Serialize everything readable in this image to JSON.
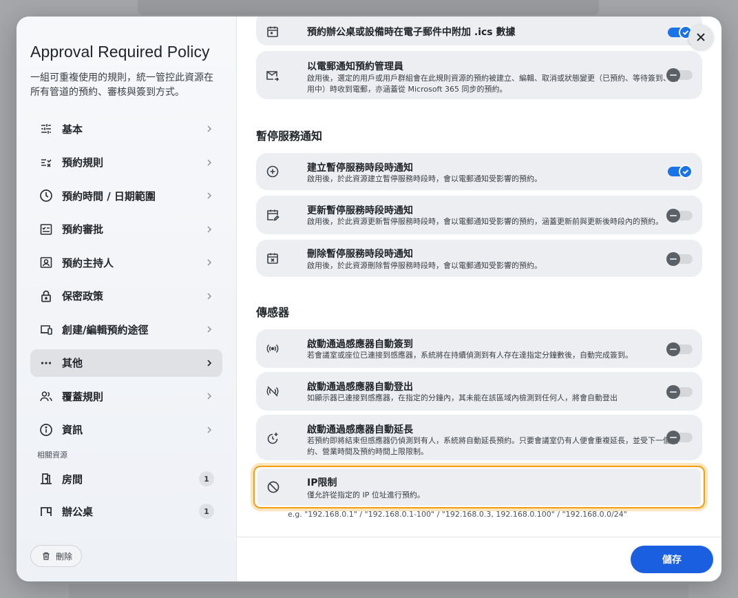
{
  "sidebar": {
    "title": "Approval Required Policy",
    "description": "一組可重複使用的規則，統一管控此資源在所有管道的預約、審核與簽到方式。",
    "nav": [
      {
        "label": "基本",
        "icon": "sliders-icon"
      },
      {
        "label": "預約規則",
        "icon": "rule-list-icon"
      },
      {
        "label": "預約時間 / 日期範圍",
        "icon": "clock-icon"
      },
      {
        "label": "預約審批",
        "icon": "approval-checklist-icon"
      },
      {
        "label": "預約主持人",
        "icon": "host-badge-icon"
      },
      {
        "label": "保密政策",
        "icon": "lock-icon"
      },
      {
        "label": "創建/編輯預約途徑",
        "icon": "devices-icon"
      },
      {
        "label": "其他",
        "icon": "more-dots-icon",
        "active": true
      },
      {
        "label": "覆蓋規則",
        "icon": "people-icon"
      },
      {
        "label": "資訊",
        "icon": "info-icon"
      }
    ],
    "related_label": "相關資源",
    "resources": [
      {
        "label": "房間",
        "count": "1",
        "icon": "door-icon"
      },
      {
        "label": "辦公桌",
        "count": "1",
        "icon": "desk-icon"
      }
    ],
    "delete_label": "刪除"
  },
  "main": {
    "items_top": [
      {
        "title": "預約辦公桌或設備時在電子郵件中附加 .ics 數據",
        "description": "",
        "enabled": true,
        "icon": "calendar-icon"
      },
      {
        "title": "以電郵通知預約管理員",
        "description": "啟用後，選定的用戶或用戶群組會在此規則資源的預約被建立、編輯、取消或狀態變更（已預約、等待簽到、使用中）時收到電郵，亦涵蓋從 Microsoft 365 同步的預約。",
        "enabled": false,
        "icon": "mail-icon"
      }
    ],
    "maintenance_heading": "暫停服務通知",
    "maintenance_items": [
      {
        "title": "建立暫停服務時段時通知",
        "description": "啟用後，於此資源建立暫停服務時段時，會以電郵通知受影響的預約。",
        "enabled": true,
        "icon": "plus-circle-icon"
      },
      {
        "title": "更新暫停服務時段時通知",
        "description": "啟用後，於此資源更新暫停服務時段時，會以電郵通知受影響的預約，涵蓋更新前與更新後時段內的預約。",
        "enabled": false,
        "icon": "calendar-edit-icon"
      },
      {
        "title": "刪除暫停服務時段時通知",
        "description": "啟用後，於此資源刪除暫停服務時段時，會以電郵通知受影響的預約。",
        "enabled": false,
        "icon": "calendar-remove-icon"
      }
    ],
    "sensor_heading": "傳感器",
    "sensor_items": [
      {
        "title": "啟動通過感應器自動簽到",
        "description": "若會議室或座位已連接到感應器，系統將在持續偵測到有人存在達指定分鐘數後，自動完成簽到。",
        "enabled": false,
        "icon": "sensor-icon"
      },
      {
        "title": "啟動通過感應器自動登出",
        "description": "如顯示器已連接到感應器，在指定的分鐘內，其未能在該區域內檢測到任何人，將會自動登出",
        "enabled": false,
        "icon": "sensor-off-icon"
      },
      {
        "title": "啟動通過感應器自動延長",
        "description": "若預約即將結束但感應器仍偵測到有人，系統將自動延長預約。只要會議室仍有人便會重複延長，並受下一個預約、營業時間及預約時間上限限制。",
        "enabled": false,
        "icon": "extend-time-icon"
      }
    ],
    "ip": {
      "title": "IP限制",
      "description": "僅允許從指定的 IP 位址進行預約。",
      "example": "e.g. \"192.168.0.1\" / \"192.168.0.1-100\" / \"192.168.0.3, 192.168.0.100\" / \"192.168.0.0/24\"",
      "icon": "block-icon"
    }
  },
  "footer": {
    "save_label": "儲存"
  },
  "colors": {
    "primary": "#1a5fe0",
    "focus": "#f29c11",
    "card": "#eceef1"
  }
}
